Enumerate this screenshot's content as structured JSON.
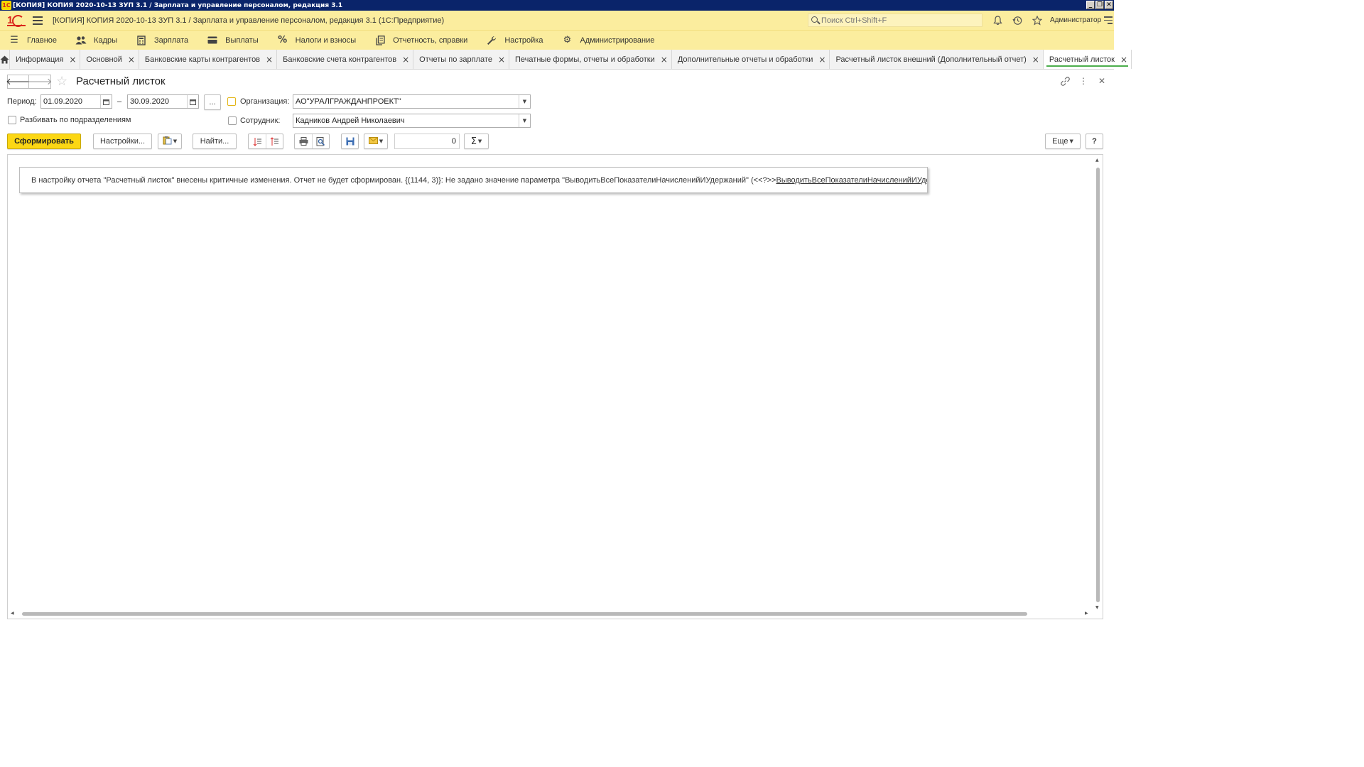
{
  "window": {
    "title": "[КОПИЯ] КОПИЯ 2020-10-13  ЗУП 3.1 / Зарплата и управление персоналом, редакция 3.1",
    "logo_small": "1C",
    "min": "_",
    "max": "❐",
    "close": "✕"
  },
  "header": {
    "app_title": "[КОПИЯ] КОПИЯ 2020-10-13  ЗУП 3.1 / Зарплата и управление персоналом, редакция 3.1  (1С:Предприятие)",
    "search_placeholder": "Поиск Ctrl+Shift+F",
    "user": "Администратор",
    "icons": [
      "bell-icon",
      "history-icon",
      "star-icon"
    ]
  },
  "sections": [
    {
      "label": "Главное",
      "icon": "☰"
    },
    {
      "label": "Кадры",
      "icon": "👥"
    },
    {
      "label": "Зарплата",
      "icon": "▦"
    },
    {
      "label": "Выплаты",
      "icon": "▬"
    },
    {
      "label": "Налоги и взносы",
      "icon": "%"
    },
    {
      "label": "Отчетность, справки",
      "icon": "❐"
    },
    {
      "label": "Настройка",
      "icon": "🔧"
    },
    {
      "label": "Администрирование",
      "icon": "⚙"
    }
  ],
  "tabs": [
    {
      "label": "Информация"
    },
    {
      "label": "Основной"
    },
    {
      "label": "Банковские карты контрагентов"
    },
    {
      "label": "Банковские счета контрагентов"
    },
    {
      "label": "Отчеты по зарплате"
    },
    {
      "label": "Печатные формы, отчеты и обработки"
    },
    {
      "label": "Дополнительные отчеты и обработки"
    },
    {
      "label": "Расчетный листок внешний (Дополнительный отчет)"
    },
    {
      "label": "Расчетный листок"
    }
  ],
  "tab_close": "×",
  "form": {
    "title": "Расчетный листок",
    "nav_back": "🡐",
    "nav_forward": "🡒",
    "star": "☆",
    "link_icon": "🔗",
    "more_icon": "⋮",
    "close_icon": "✕"
  },
  "filters": {
    "period_label": "Период:",
    "date_from": "01.09.2020",
    "dash": "–",
    "date_to": "30.09.2020",
    "period_select": "...",
    "org_label": "Организация:",
    "org_value": "АО\"УРАЛГРАЖДАНПРОЕКТ\"",
    "split_label": "Разбивать по подразделениям",
    "employee_label": "Сотрудник:",
    "employee_value": "Кадников Андрей Николаевич"
  },
  "commandbar": {
    "generate": "Сформировать",
    "settings": "Настройки...",
    "find": "Найти...",
    "number_value": "0",
    "sigma": "Σ",
    "more": "Еще",
    "help": "?"
  },
  "report": {
    "message_prefix": "В настройку отчета \"Расчетный листок\" внесены критичные изменения. Отчет не будет сформирован. {(1144, 3)}: Не задано значение параметра \"ВыводитьВсеПоказателиНачисленийИУдержаний\" (<<?>>",
    "message_link": "ВыводитьВсеПоказателиНачисленийИУдержаний"
  }
}
